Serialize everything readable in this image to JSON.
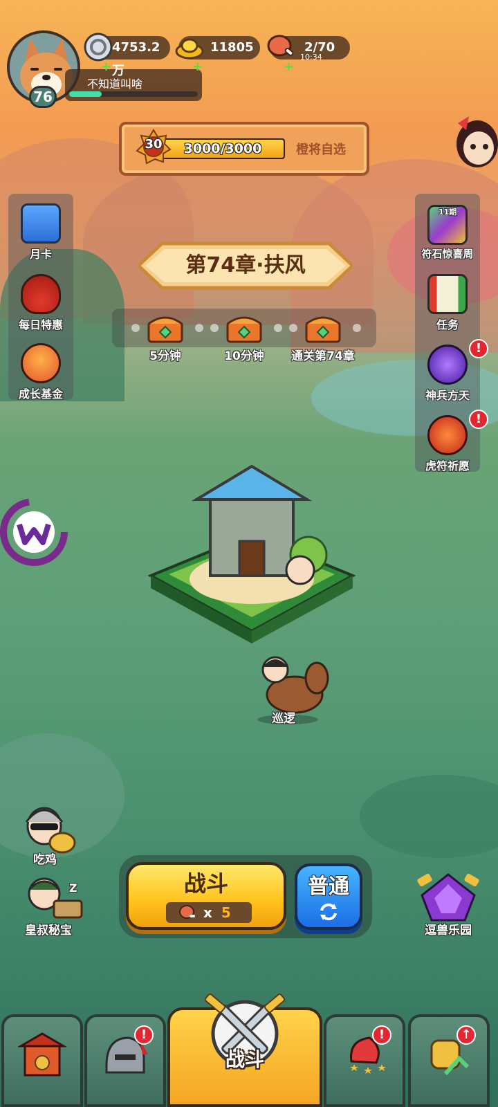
{
  "player": {
    "level": "76",
    "name": "不知道叫啥",
    "xp_fraction": 0.25
  },
  "resources": [
    {
      "icon": "silver-coin-icon",
      "value": "4753.2万"
    },
    {
      "icon": "gold-ingot-icon",
      "value": "11805"
    },
    {
      "icon": "meat-stamina-icon",
      "value": "2/70",
      "timer": "10:34"
    }
  ],
  "general_select": {
    "level": "30",
    "progress_text": "3000/3000",
    "progress_fraction": 1.0,
    "label": "橙将自选"
  },
  "left_menu": [
    {
      "label": "月卡",
      "icon": "month-card-icon"
    },
    {
      "label": "每日特惠",
      "icon": "gift-bag-icon"
    },
    {
      "label": "成长基金",
      "icon": "growth-fund-icon"
    }
  ],
  "right_menu": [
    {
      "label": "符石惊喜周",
      "icon": "rune-stone-icon",
      "sub": "11期"
    },
    {
      "label": "任务",
      "icon": "quest-scroll-icon"
    },
    {
      "label": "神兵方天",
      "icon": "divine-weapon-icon",
      "alert": "!"
    },
    {
      "label": "虎符祈愿",
      "icon": "tiger-tally-icon",
      "alert": "!"
    }
  ],
  "chapter": {
    "title": "第74章·扶风",
    "rewards": [
      {
        "label": "5分钟",
        "icon": "treasure-chest-icon"
      },
      {
        "label": "10分钟",
        "icon": "treasure-chest-icon"
      },
      {
        "label": "通关第74章",
        "icon": "treasure-chest-icon"
      }
    ]
  },
  "patrol": {
    "label": "巡逻"
  },
  "characters": {
    "eat_chicken": "吃鸡",
    "uncle_treasure": "皇叔秘宝",
    "uncle_sleep": "Z",
    "beast_park": "逗兽乐园"
  },
  "battle": {
    "label": "战斗",
    "cost_prefix": "x",
    "cost": "5",
    "mode": "普通"
  },
  "bottom_nav": [
    {
      "icon": "city-gate-icon"
    },
    {
      "icon": "helmet-icon",
      "alert": "!"
    },
    {
      "label": "战斗",
      "icon": "crossed-swords-icon"
    },
    {
      "icon": "bird-stars-icon",
      "alert": "!"
    },
    {
      "icon": "fist-upgrade-icon",
      "alert": "↑"
    }
  ],
  "colors": {
    "accent_yellow": "#ffc21a",
    "accent_blue": "#1c6ee6",
    "alert_red": "#e3262f",
    "xp_green": "#3fe0a8"
  }
}
